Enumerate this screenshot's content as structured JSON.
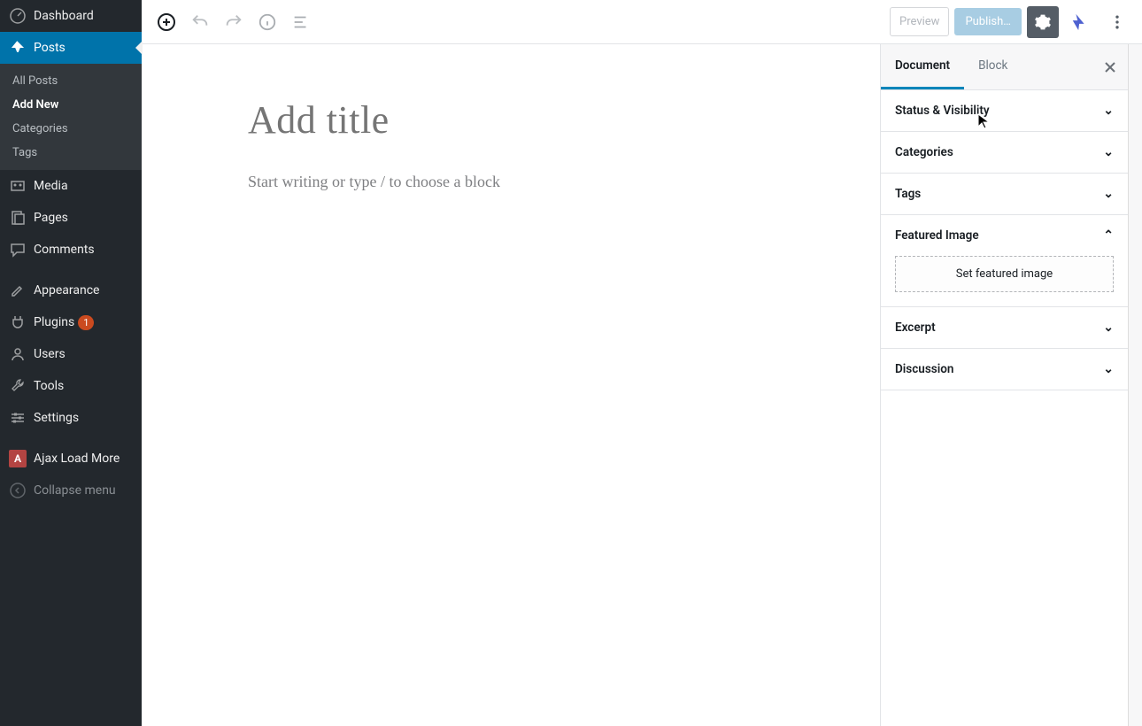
{
  "sidebar": {
    "dashboard": "Dashboard",
    "posts": "Posts",
    "posts_sub": {
      "all": "All Posts",
      "add": "Add New",
      "cat": "Categories",
      "tags": "Tags"
    },
    "media": "Media",
    "pages": "Pages",
    "comments": "Comments",
    "appearance": "Appearance",
    "plugins": "Plugins",
    "plugins_badge": "1",
    "users": "Users",
    "tools": "Tools",
    "settings": "Settings",
    "alm": "Ajax Load More",
    "alm_initial": "A",
    "collapse": "Collapse menu"
  },
  "topbar": {
    "preview": "Preview",
    "publish": "Publish…"
  },
  "editor": {
    "title_placeholder": "Add title",
    "body_placeholder": "Start writing or type / to choose a block"
  },
  "inspector": {
    "tabs": {
      "document": "Document",
      "block": "Block"
    },
    "panels": {
      "status": "Status & Visibility",
      "categories": "Categories",
      "tags": "Tags",
      "featured": "Featured Image",
      "set_featured": "Set featured image",
      "excerpt": "Excerpt",
      "discussion": "Discussion"
    }
  }
}
